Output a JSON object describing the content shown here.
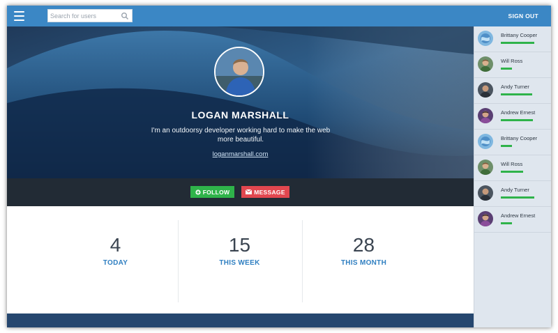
{
  "search": {
    "placeholder": "Search for users"
  },
  "header": {
    "sign_out": "SIGN OUT"
  },
  "profile": {
    "name": "LOGAN MARSHALL",
    "bio": "I'm an outdoorsy developer working hard to make the web more beautiful.",
    "link": "loganmarshall.com"
  },
  "actions": {
    "follow": "FOLLOW",
    "message": "MESSAGE"
  },
  "stats": [
    {
      "value": "4",
      "label": "TODAY"
    },
    {
      "value": "15",
      "label": "THIS WEEK"
    },
    {
      "value": "28",
      "label": "THIS MONTH"
    }
  ],
  "users": [
    {
      "name": "Brittany Cooper",
      "level": 0.82,
      "avatar": "globe"
    },
    {
      "name": "Will Ross",
      "level": 0.27,
      "avatar": "man"
    },
    {
      "name": "Andy Turner",
      "level": 0.78,
      "avatar": "dark"
    },
    {
      "name": "Andrew Ernest",
      "level": 0.8,
      "avatar": "purple"
    },
    {
      "name": "Brittany Cooper",
      "level": 0.27,
      "avatar": "globe"
    },
    {
      "name": "Will Ross",
      "level": 0.56,
      "avatar": "man"
    },
    {
      "name": "Andy Turner",
      "level": 0.82,
      "avatar": "dark"
    },
    {
      "name": "Andrew Ernest",
      "level": 0.27,
      "avatar": "purple"
    }
  ],
  "colors": {
    "topbar": "#3b87c5",
    "follow": "#2fb34a",
    "message": "#e2474f",
    "stat_label": "#2f7fc1",
    "progress": "#2fb34a"
  }
}
